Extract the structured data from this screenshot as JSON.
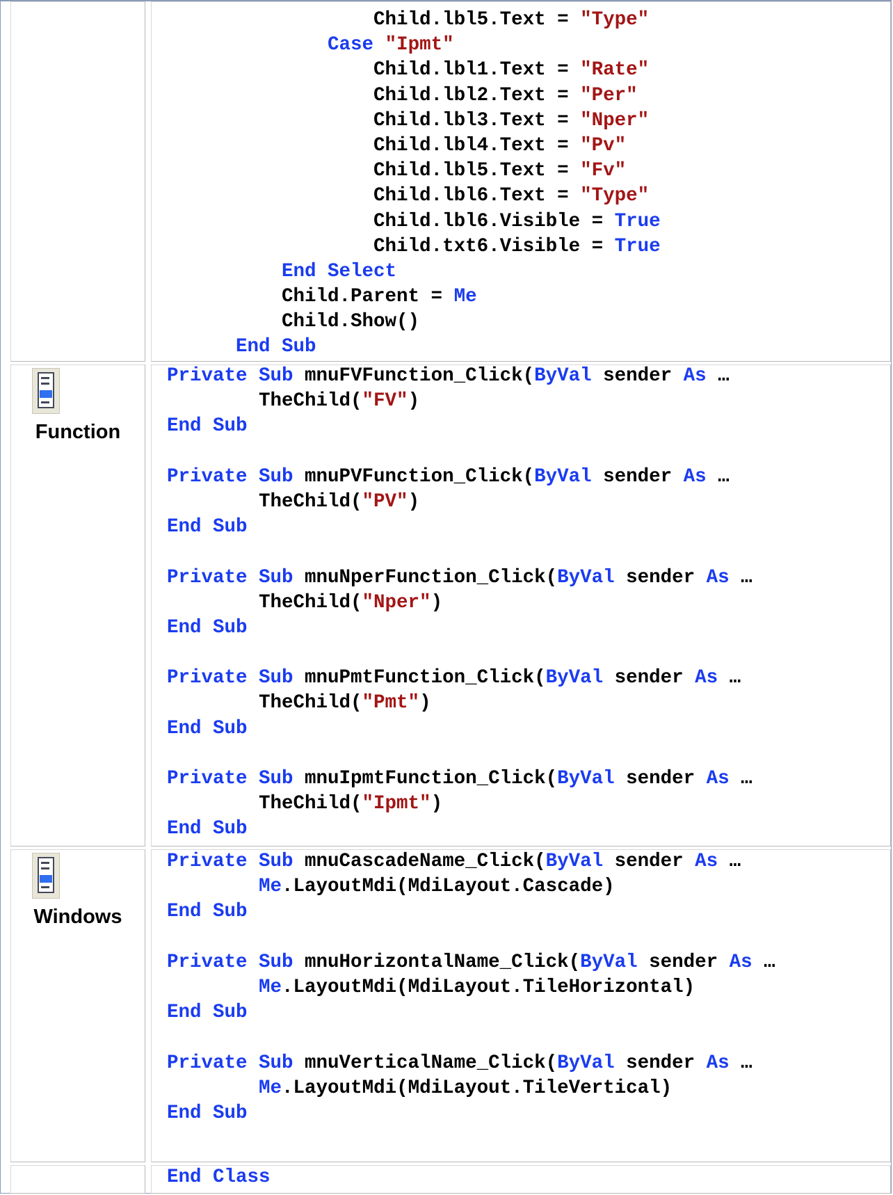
{
  "code_listing": {
    "block1": [
      [
        {
          "t": "                  Child.lbl5.Text = "
        },
        {
          "s": "\"Type\""
        }
      ],
      [
        {
          "t": "              "
        },
        {
          "k": "Case"
        },
        {
          "t": " "
        },
        {
          "s": "\"Ipmt\""
        }
      ],
      [
        {
          "t": "                  Child.lbl1.Text = "
        },
        {
          "s": "\"Rate\""
        }
      ],
      [
        {
          "t": "                  Child.lbl2.Text = "
        },
        {
          "s": "\"Per\""
        }
      ],
      [
        {
          "t": "                  Child.lbl3.Text = "
        },
        {
          "s": "\"Nper\""
        }
      ],
      [
        {
          "t": "                  Child.lbl4.Text = "
        },
        {
          "s": "\"Pv\""
        }
      ],
      [
        {
          "t": "                  Child.lbl5.Text = "
        },
        {
          "s": "\"Fv\""
        }
      ],
      [
        {
          "t": "                  Child.lbl6.Text = "
        },
        {
          "s": "\"Type\""
        }
      ],
      [
        {
          "t": "                  Child.lbl6.Visible = "
        },
        {
          "k": "True"
        }
      ],
      [
        {
          "t": "                  Child.txt6.Visible = "
        },
        {
          "k": "True"
        }
      ],
      [
        {
          "t": "          "
        },
        {
          "k": "End Select"
        }
      ],
      [
        {
          "t": "          Child.Parent = "
        },
        {
          "k": "Me"
        }
      ],
      [
        {
          "t": "          Child.Show()"
        }
      ],
      [
        {
          "t": "      "
        },
        {
          "k": "End Sub"
        }
      ]
    ],
    "block2": [
      [
        {
          "k": "Private Sub"
        },
        {
          "t": " mnuFVFunction_Click("
        },
        {
          "k": "ByVal"
        },
        {
          "t": " sender "
        },
        {
          "k": "As"
        },
        {
          "t": " …"
        }
      ],
      [
        {
          "t": "        TheChild("
        },
        {
          "s": "\"FV\""
        },
        {
          "t": ")"
        }
      ],
      [
        {
          "k": "End Sub"
        }
      ],
      [],
      [
        {
          "k": "Private Sub"
        },
        {
          "t": " mnuPVFunction_Click("
        },
        {
          "k": "ByVal"
        },
        {
          "t": " sender "
        },
        {
          "k": "As"
        },
        {
          "t": " …"
        }
      ],
      [
        {
          "t": "        TheChild("
        },
        {
          "s": "\"PV\""
        },
        {
          "t": ")"
        }
      ],
      [
        {
          "k": "End Sub"
        }
      ],
      [],
      [
        {
          "k": "Private Sub"
        },
        {
          "t": " mnuNperFunction_Click("
        },
        {
          "k": "ByVal"
        },
        {
          "t": " sender "
        },
        {
          "k": "As"
        },
        {
          "t": " …"
        }
      ],
      [
        {
          "t": "        TheChild("
        },
        {
          "s": "\"Nper\""
        },
        {
          "t": ")"
        }
      ],
      [
        {
          "k": "End Sub"
        }
      ],
      [],
      [
        {
          "k": "Private Sub"
        },
        {
          "t": " mnuPmtFunction_Click("
        },
        {
          "k": "ByVal"
        },
        {
          "t": " sender "
        },
        {
          "k": "As"
        },
        {
          "t": " …"
        }
      ],
      [
        {
          "t": "        TheChild("
        },
        {
          "s": "\"Pmt\""
        },
        {
          "t": ")"
        }
      ],
      [
        {
          "k": "End Sub"
        }
      ],
      [],
      [
        {
          "k": "Private Sub"
        },
        {
          "t": " mnuIpmtFunction_Click("
        },
        {
          "k": "ByVal"
        },
        {
          "t": " sender "
        },
        {
          "k": "As"
        },
        {
          "t": " …"
        }
      ],
      [
        {
          "t": "        TheChild("
        },
        {
          "s": "\"Ipmt\""
        },
        {
          "t": ")"
        }
      ],
      [
        {
          "k": "End Sub"
        }
      ]
    ],
    "block3": [
      [
        {
          "k": "Private Sub"
        },
        {
          "t": " mnuCascadeName_Click("
        },
        {
          "k": "ByVal"
        },
        {
          "t": " sender "
        },
        {
          "k": "As"
        },
        {
          "t": " …"
        }
      ],
      [
        {
          "t": "        "
        },
        {
          "k": "Me"
        },
        {
          "t": ".LayoutMdi(MdiLayout.Cascade)"
        }
      ],
      [
        {
          "k": "End Sub"
        }
      ],
      [],
      [
        {
          "k": "Private Sub"
        },
        {
          "t": " mnuHorizontalName_Click("
        },
        {
          "k": "ByVal"
        },
        {
          "t": " sender "
        },
        {
          "k": "As"
        },
        {
          "t": " …"
        }
      ],
      [
        {
          "t": "        "
        },
        {
          "k": "Me"
        },
        {
          "t": ".LayoutMdi(MdiLayout.TileHorizontal)"
        }
      ],
      [
        {
          "k": "End Sub"
        }
      ],
      [],
      [
        {
          "k": "Private Sub"
        },
        {
          "t": " mnuVerticalName_Click("
        },
        {
          "k": "ByVal"
        },
        {
          "t": " sender "
        },
        {
          "k": "As"
        },
        {
          "t": " …"
        }
      ],
      [
        {
          "t": "        "
        },
        {
          "k": "Me"
        },
        {
          "t": ".LayoutMdi(MdiLayout.TileVertical)"
        }
      ],
      [
        {
          "k": "End Sub"
        }
      ]
    ],
    "block4": [
      [
        {
          "k": "End Class"
        }
      ]
    ]
  },
  "categories": {
    "function_label": "Function",
    "windows_label": "Windows",
    "icon_name": "menu-item-icon"
  },
  "colors": {
    "keyword": "#1a3cf0",
    "string": "#a31515",
    "text": "#000000"
  }
}
